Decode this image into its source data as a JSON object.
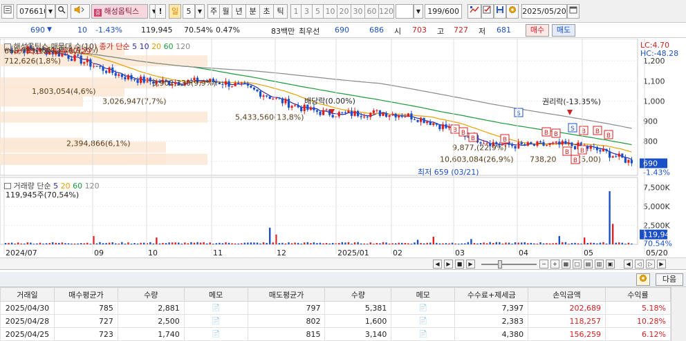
{
  "toolbar": {
    "code": "076610",
    "name": "해성옵틱스",
    "flag_label": "!",
    "period_active": "일",
    "period_value": "5",
    "periods": [
      "주",
      "월",
      "년",
      "분",
      "초",
      "틱"
    ],
    "intervals": [
      "1",
      "3",
      "5",
      "10",
      "20",
      "30",
      "60",
      "120"
    ],
    "count": "199/600",
    "date": "2025/05/20"
  },
  "quote": {
    "price": "690",
    "change": "10",
    "rate": "-1.43%",
    "volume": "119,945",
    "vol_ratio": "70.54%",
    "turnover": "0.47%",
    "amount": "83백만",
    "best_label": "최우선",
    "best_bid": "690",
    "best_ask": "686",
    "open_label": "시",
    "open": "703",
    "high_label": "고",
    "high": "727",
    "low_label": "저",
    "low": "681",
    "buy_label": "매수",
    "sell_label": "매도"
  },
  "chart_data": {
    "type": "candlestick",
    "title": "해성옵틱스 매물대 수(10)",
    "ma_legend": {
      "label": "종가 단순",
      "periods": [
        "5",
        "10",
        "20",
        "60",
        "120"
      ]
    },
    "lc_label": "LC:4.70",
    "hc_label": "HC:-48.28",
    "y_ticks": [
      "1,200",
      "1,100",
      "1,000",
      "900",
      "800",
      "700"
    ],
    "ylim": [
      630,
      1290
    ],
    "current_price": "690",
    "current_rate": "-1.43%",
    "high_annotation": "최고 1,334(07/29)",
    "low_annotation": "최저 659 (03/21)",
    "events": [
      {
        "label": "배당락(0.00%)",
        "date": "2024/12/27"
      },
      {
        "label": "권리락(-13.35%)",
        "date": "2025/05/02"
      }
    ],
    "volume_profile": [
      {
        "label": "2,394,866(6,1%)",
        "price": 790
      },
      {
        "label": "10,603,084(26,9%)",
        "price": 710
      },
      {
        "label": "9,877,(22,9%)",
        "price": 770
      },
      {
        "label": "5,433,560(13,8%)",
        "price": 920
      },
      {
        "label": "3,026,947(7,7%)",
        "price": 1000
      },
      {
        "label": "1,803,054(4,6%)",
        "price": 1050
      },
      {
        "label": "3,902,330(9,9%)",
        "price": 1090
      },
      {
        "label": "712,626(1,8%)",
        "price": 1200
      },
      {
        "label": "665,753(1,7%)",
        "price": 1250
      },
      {
        "label": "861,214(4,7%)",
        "price": 1255
      },
      {
        "label": "738,20",
        "price": 710
      },
      {
        "label": "(5,00)",
        "price": 710
      }
    ],
    "volume_panel": {
      "title": "거래량 단순",
      "periods": [
        "5",
        "20",
        "60",
        "120"
      ],
      "last": "119,945주(70,54%)",
      "y_ticks": [
        "7,500K",
        "5,000K",
        "2,500K"
      ],
      "current": "119,945",
      "current_rate": "70.54%"
    },
    "x_labels": [
      "2024/07",
      "09",
      "10",
      "11",
      "12",
      "2025/01",
      "02",
      "03",
      "04",
      "05",
      "05/20"
    ]
  },
  "colors": {
    "up": "#e02020",
    "down": "#1a4fc8",
    "ma5": "#2a2aa8",
    "ma20": "#e8a000",
    "ma60": "#1c9a3a",
    "ma120": "#8a8a8a",
    "profile": "#fbe8d4"
  },
  "table": {
    "next_label": "다음",
    "headers": [
      "거래일",
      "매수평균가",
      "수량",
      "메모",
      "매도평균가",
      "수량",
      "메모",
      "수수료+제세금",
      "손익금액",
      "수익률"
    ],
    "rows": [
      {
        "date": "2025/04/30",
        "buy_avg": "785",
        "buy_qty": "2,881",
        "sell_avg": "797",
        "sell_qty": "5,381",
        "fee": "7,397",
        "pnl": "202,689",
        "rate": "5.18%"
      },
      {
        "date": "2025/04/28",
        "buy_avg": "727",
        "buy_qty": "2,500",
        "sell_avg": "802",
        "sell_qty": "1,600",
        "fee": "2,383",
        "pnl": "118,257",
        "rate": "10.28%"
      },
      {
        "date": "2025/04/25",
        "buy_avg": "723",
        "buy_qty": "1,740",
        "sell_avg": "815",
        "sell_qty": "3,140",
        "fee": "4,380",
        "pnl": "156,259",
        "rate": "6.12%"
      }
    ]
  }
}
